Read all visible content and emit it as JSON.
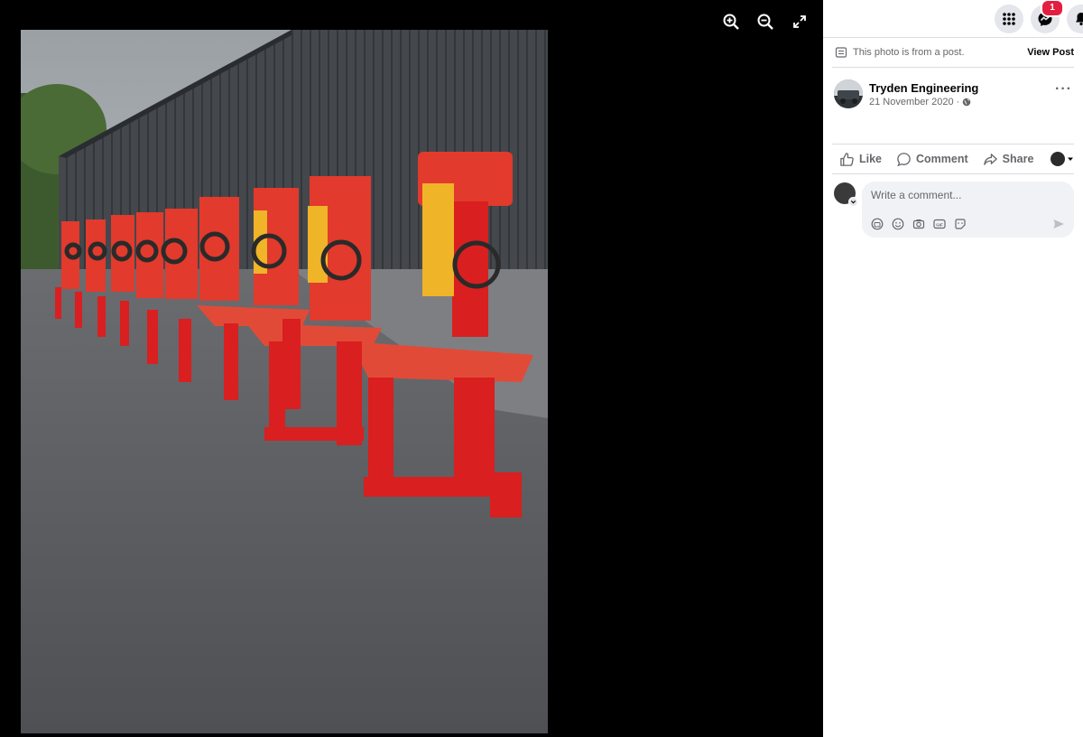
{
  "viewer": {
    "photo_alt": "Row of red wrapped log splitters outside a grey metal building",
    "tools": [
      "zoom-in-icon",
      "zoom-out-icon",
      "fullscreen-icon"
    ]
  },
  "topbar": {
    "messenger_badge": "1"
  },
  "notice": {
    "text": "This photo is from a post.",
    "link": "View Post"
  },
  "post": {
    "author": "Tryden Engineering",
    "date": "21 November 2020 ·",
    "more": "···"
  },
  "actions": {
    "like": "Like",
    "comment": "Comment",
    "share": "Share"
  },
  "comment": {
    "placeholder": "Write a comment..."
  },
  "colors": {
    "accent_red": "#e41e3f",
    "panel_bg": "#ffffff",
    "input_bg": "#f0f2f5",
    "muted_text": "#65676b"
  }
}
